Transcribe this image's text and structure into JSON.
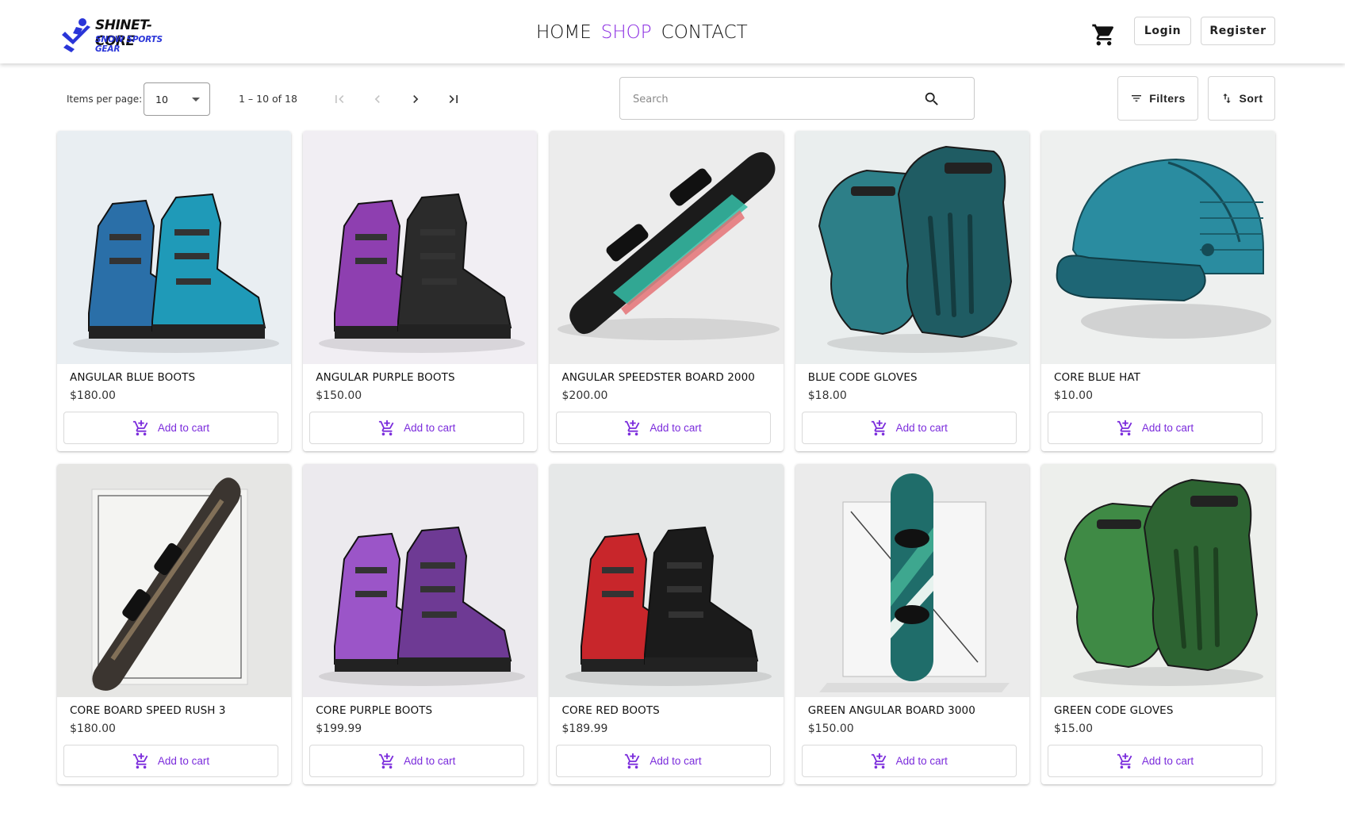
{
  "brand": {
    "name": "SHINET-CORE",
    "tagline": "SNOW SPORTS GEAR",
    "accent": "#8a2be2",
    "logo_color": "#2a35d8"
  },
  "nav": [
    {
      "label": "HOME",
      "active": false
    },
    {
      "label": "SHOP",
      "active": true
    },
    {
      "label": "CONTACT",
      "active": false
    }
  ],
  "header": {
    "cart_icon": "cart-icon",
    "login_label": "Login",
    "register_label": "Register"
  },
  "paginator": {
    "items_per_page_label": "Items per page:",
    "items_per_page_value": "10",
    "range_label": "1 – 10 of 18"
  },
  "search": {
    "placeholder": "Search",
    "value": ""
  },
  "toolbar": {
    "filters_label": "Filters",
    "sort_label": "Sort"
  },
  "products": [
    {
      "name": "ANGULAR BLUE BOOTS",
      "price": "$180.00",
      "kind": "boots",
      "color": "#2a6fa8",
      "color2": "#1f9ab8",
      "bg": "#e9eef2",
      "action": "Add to cart"
    },
    {
      "name": "ANGULAR PURPLE BOOTS",
      "price": "$150.00",
      "kind": "boots",
      "color": "#8e3fb0",
      "color2": "#2b2b2b",
      "bg": "#f1eef3",
      "action": "Add to cart"
    },
    {
      "name": "ANGULAR SPEEDSTER BOARD 2000",
      "price": "$200.00",
      "kind": "board",
      "color": "#1b1b1b",
      "color2": "#35c0a8",
      "bg": "#ececec",
      "action": "Add to cart"
    },
    {
      "name": "BLUE CODE GLOVES",
      "price": "$18.00",
      "kind": "gloves",
      "color": "#2d7f88",
      "color2": "#1f5c63",
      "bg": "#eaeeee",
      "action": "Add to cart"
    },
    {
      "name": "CORE BLUE HAT",
      "price": "$10.00",
      "kind": "hat",
      "color": "#2a8ca0",
      "color2": "#1e6675",
      "bg": "#eef0ef",
      "action": "Add to cart"
    },
    {
      "name": "CORE BOARD SPEED RUSH 3",
      "price": "$180.00",
      "kind": "board2",
      "color": "#3b3530",
      "color2": "#a08a6a",
      "bg": "#e6e6e4",
      "action": "Add to cart"
    },
    {
      "name": "CORE PURPLE BOOTS",
      "price": "$199.99",
      "kind": "boots",
      "color": "#9b55c8",
      "color2": "#6e3a94",
      "bg": "#eceaee",
      "action": "Add to cart"
    },
    {
      "name": "CORE RED BOOTS",
      "price": "$189.99",
      "kind": "boots",
      "color": "#c8262b",
      "color2": "#1b1b1b",
      "bg": "#e6e8e8",
      "action": "Add to cart"
    },
    {
      "name": "GREEN ANGULAR BOARD 3000",
      "price": "$150.00",
      "kind": "board3",
      "color": "#1f6d6a",
      "color2": "#3ea78f",
      "bg": "#ebebeb",
      "action": "Add to cart"
    },
    {
      "name": "GREEN CODE GLOVES",
      "price": "$15.00",
      "kind": "gloves",
      "color": "#3f8a45",
      "color2": "#2d6432",
      "bg": "#edefec",
      "action": "Add to cart"
    }
  ]
}
